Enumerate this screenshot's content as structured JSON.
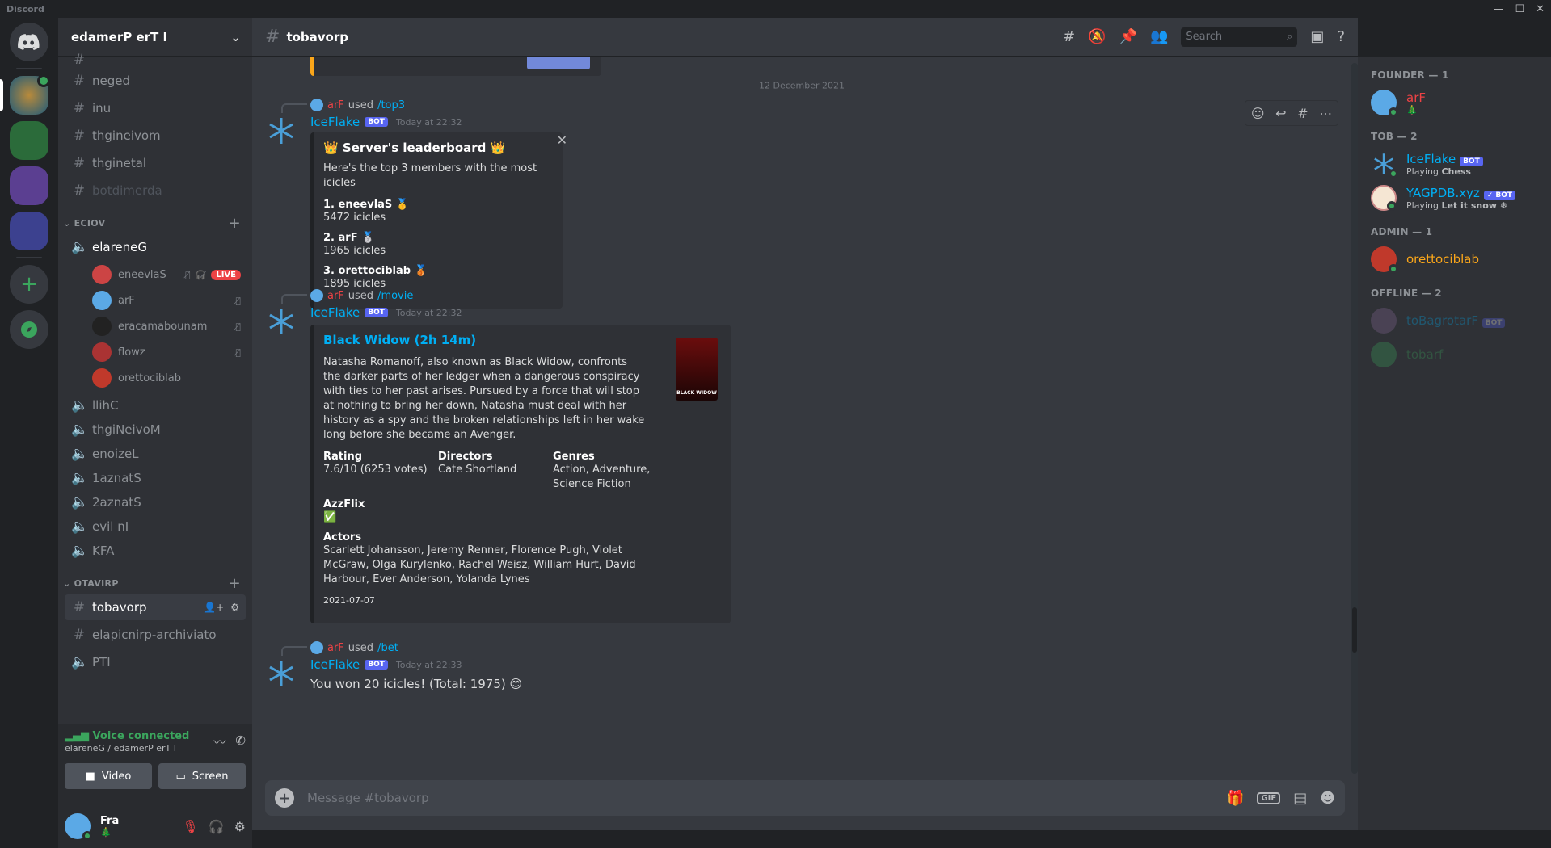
{
  "app": {
    "name": "Discord",
    "window_controls": [
      "—",
      "☐",
      "✕"
    ]
  },
  "server": {
    "name": "edamerP erT I"
  },
  "channels_top": [
    "neged",
    "inu",
    "thgineivom",
    "thginetal",
    "botdimerda"
  ],
  "voice_category": "ECIOV",
  "voice_channel_active": "elareneG",
  "voice_users": [
    {
      "name": "eneevlaS",
      "live": "LIVE"
    },
    {
      "name": "arF"
    },
    {
      "name": "eracamabounam"
    },
    {
      "name": "flowz"
    },
    {
      "name": "orettociblab"
    }
  ],
  "voice_channels": [
    "llihC",
    "thgiNeivoM",
    "enoizeL",
    "1aznatS",
    "2aznatS",
    "evil nI",
    "KFA"
  ],
  "private_category": "OTAVIRP",
  "private_channels": [
    "tobavorp",
    "elapicnirp-archiviato",
    "PTI"
  ],
  "voice_panel": {
    "status": "Voice connected",
    "sub": "elareneG / edamerP erT I",
    "video": "Video",
    "screen": "Screen"
  },
  "user": {
    "name": "Fra",
    "tag": "🎄"
  },
  "channel": {
    "name": "tobavorp",
    "search_placeholder": "Search",
    "compose_placeholder": "Message #tobavorp"
  },
  "date_separator": "12 December 2021",
  "messages": [
    {
      "reply_user": "arF",
      "reply_used": "used",
      "reply_cmd": "/top3",
      "author": "IceFlake",
      "bot": "BOT",
      "time": "Today at 22:32",
      "embed": {
        "title": "👑 Server's leaderboard 👑",
        "desc": "Here's the top 3 members with the most icicles",
        "entries": [
          {
            "rank": "1. eneevlaS 🥇",
            "value": "5472 icicles"
          },
          {
            "rank": "2. arF 🥈",
            "value": "1965 icicles"
          },
          {
            "rank": "3. orettociblab 🥉",
            "value": "1895 icicles"
          }
        ]
      }
    },
    {
      "reply_user": "arF",
      "reply_used": "used",
      "reply_cmd": "/movie",
      "author": "IceFlake",
      "bot": "BOT",
      "time": "Today at 22:32",
      "embed": {
        "title": "Black Widow (2h 14m)",
        "desc": "Natasha Romanoff, also known as Black Widow, confronts the darker parts of her ledger when a dangerous conspiracy with ties to her past arises. Pursued by a force that will stop at nothing to bring her down, Natasha must deal with her history as a spy and the broken relationships left in her wake long before she became an Avenger.",
        "rating_label": "Rating",
        "rating": "7.6/10 (6253 votes)",
        "directors_label": "Directors",
        "directors": "Cate Shortland",
        "genres_label": "Genres",
        "genres": "Action, Adventure, Science Fiction",
        "azz_label": "AzzFlix",
        "azz": "✅",
        "actors_label": "Actors",
        "actors": "Scarlett Johansson, Jeremy Renner, Florence Pugh, Violet McGraw, Olga Kurylenko, Rachel Weisz, William Hurt, David Harbour, Ever Anderson, Yolanda Lynes",
        "footer": "2021-07-07",
        "poster_text": "BLACK WIDOW"
      }
    },
    {
      "reply_user": "arF",
      "reply_used": "used",
      "reply_cmd": "/bet",
      "author": "IceFlake",
      "bot": "BOT",
      "time": "Today at 22:33",
      "content": "You won 20 icicles! (Total: 1975) 😊"
    }
  ],
  "members": {
    "founder": "FOUNDER — 1",
    "founder_list": [
      {
        "name": "arF",
        "sub": "🎄"
      }
    ],
    "bots": "TOB — 2",
    "bot_list": [
      {
        "name": "IceFlake",
        "badge": "BOT",
        "activity_prefix": "Playing",
        "activity": "Chess"
      },
      {
        "name": "YAGPDB.xyz",
        "badge": "✓ BOT",
        "activity_prefix": "Playing",
        "activity": "Let it snow ❄"
      }
    ],
    "admin": "ADMIN — 1",
    "admin_list": [
      {
        "name": "orettociblab"
      }
    ],
    "offline": "OFFLINE — 2",
    "offline_list": [
      {
        "name": "toBagrotarF",
        "badge": "BOT"
      },
      {
        "name": "tobarf"
      }
    ]
  }
}
